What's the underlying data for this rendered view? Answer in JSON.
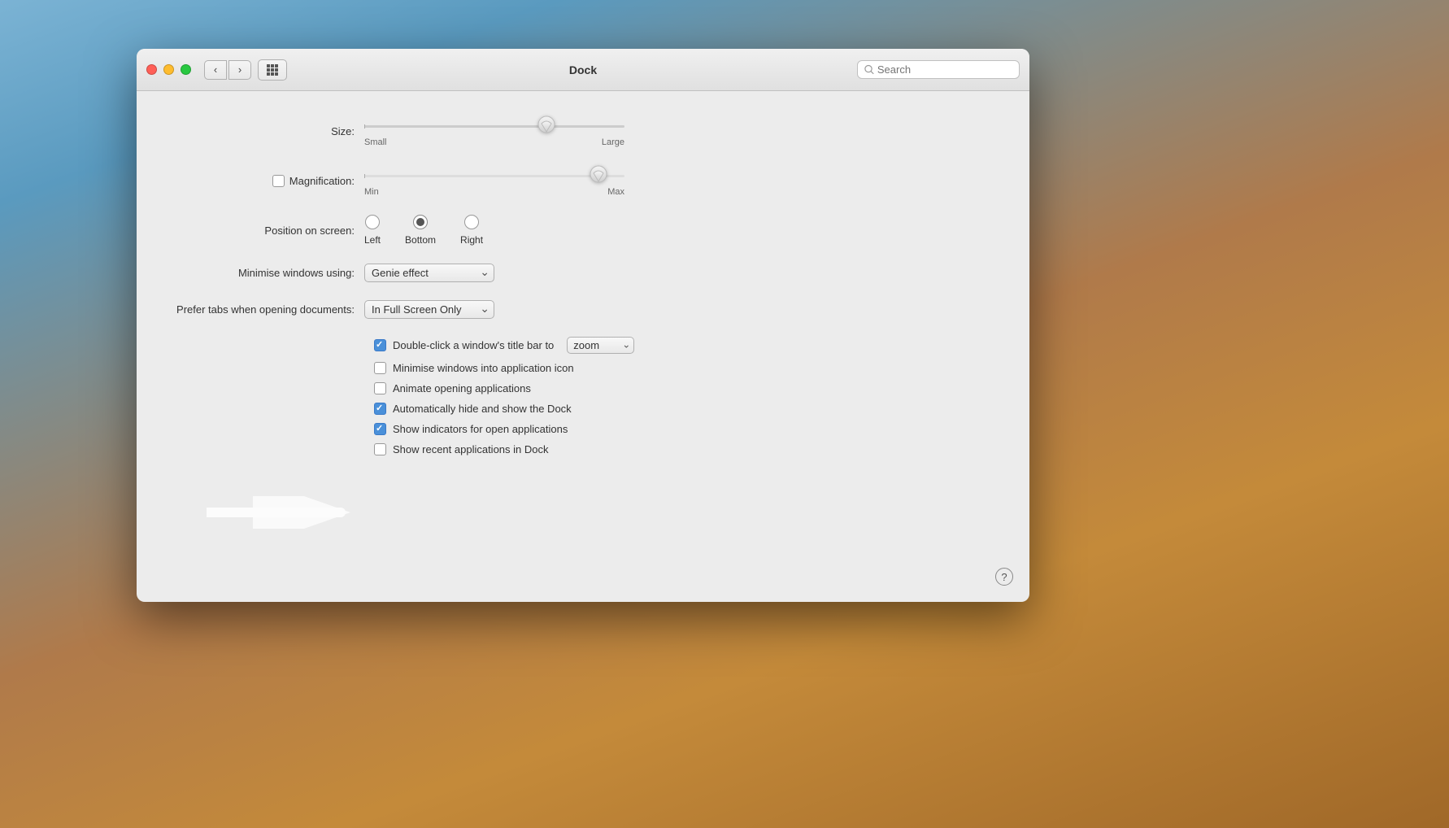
{
  "window": {
    "title": "Dock"
  },
  "titlebar": {
    "back_label": "‹",
    "forward_label": "›",
    "grid_label": "⊞",
    "search_placeholder": "Search"
  },
  "settings": {
    "size_label": "Size:",
    "size_small": "Small",
    "size_large": "Large",
    "size_value": 70,
    "magnification_label": "Magnification:",
    "magnification_min": "Min",
    "magnification_max": "Max",
    "magnification_value": 90,
    "position_label": "Position on screen:",
    "position_left": "Left",
    "position_bottom": "Bottom",
    "position_right": "Right",
    "position_selected": "Bottom",
    "minimise_label": "Minimise windows using:",
    "minimise_effect": "Genie effect",
    "prefer_tabs_label": "Prefer tabs when opening documents:",
    "prefer_tabs_value": "In Full Screen Only",
    "double_click_label": "Double-click a window's title bar to",
    "double_click_action": "zoom",
    "checkbox_minimise": "Minimise windows into application icon",
    "checkbox_animate": "Animate opening applications",
    "checkbox_autohide": "Automatically hide and show the Dock",
    "checkbox_indicators": "Show indicators for open applications",
    "checkbox_recent": "Show recent applications in Dock",
    "checkbox_minimise_checked": false,
    "checkbox_animate_checked": false,
    "checkbox_autohide_checked": true,
    "checkbox_indicators_checked": true,
    "checkbox_recent_checked": false,
    "checkbox_double_click_checked": true
  },
  "help": {
    "label": "?"
  }
}
